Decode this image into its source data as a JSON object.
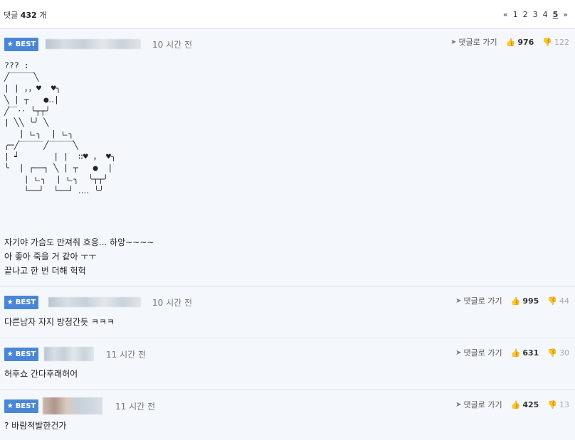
{
  "header": {
    "count_label": "댓글",
    "count_value": "432",
    "count_unit": "개",
    "pager": {
      "prev": "«",
      "pages": [
        "1",
        "2",
        "3",
        "4",
        "5"
      ],
      "current": "5",
      "next": "»"
    }
  },
  "comments": [
    {
      "badge": "BEST",
      "time": "10 시간 전",
      "reply_label": "댓글로 가기",
      "up": "976",
      "down": "122",
      "art": "??? :\n╱￣￣￣╲\n| | ，，♥  ♥╮\n╲ | ┬   ●‥|\n╱￣‥ ╰┬┬╯\n| ╲╲ ╰╯ ╲\n   | ㄴ╮  | ㄴ╮\n╭─╱￣￣￣╱￣￣￣╲\n| ┙       | |  ∷♥ ， ♥╮\n╰  | ┌──┐ ╲ | ┬   ●  |\n    | ㄴ╮  | ㄴ╮  ╰┬┬╯\n    └──┘  └──┘ ‥‥ ╰╯",
      "lines": [
        "자기야 가슴도 만져줘 흐응... 하앙~~~~",
        "아 좋아 죽을 거 같아 ㅜㅜ",
        "끝나고 한 번 더해 헉헉"
      ]
    },
    {
      "badge": "BEST",
      "time": "10 시간 전",
      "reply_label": "댓글로 가기",
      "up": "995",
      "down": "44",
      "lines": [
        "다른남자 자지 방청간듯 ㅋㅋㅋ"
      ]
    },
    {
      "badge": "BEST",
      "time": "11 시간 전",
      "reply_label": "댓글로 가기",
      "up": "631",
      "down": "30",
      "lines": [
        "허후쇼 간다후래허어"
      ]
    },
    {
      "badge": "BEST",
      "time": "11 시간 전",
      "reply_label": "댓글로 가기",
      "up": "425",
      "down": "13",
      "lines": [
        "? 바람적발한건가"
      ]
    }
  ],
  "icons": {
    "star": "star-icon",
    "reply": "send-arrow-icon",
    "thumbs_up": "thumbs-up-icon",
    "thumbs_down": "thumbs-down-icon"
  },
  "colors": {
    "best_badge": "#4a86d8",
    "background": "#f4f8fd"
  }
}
